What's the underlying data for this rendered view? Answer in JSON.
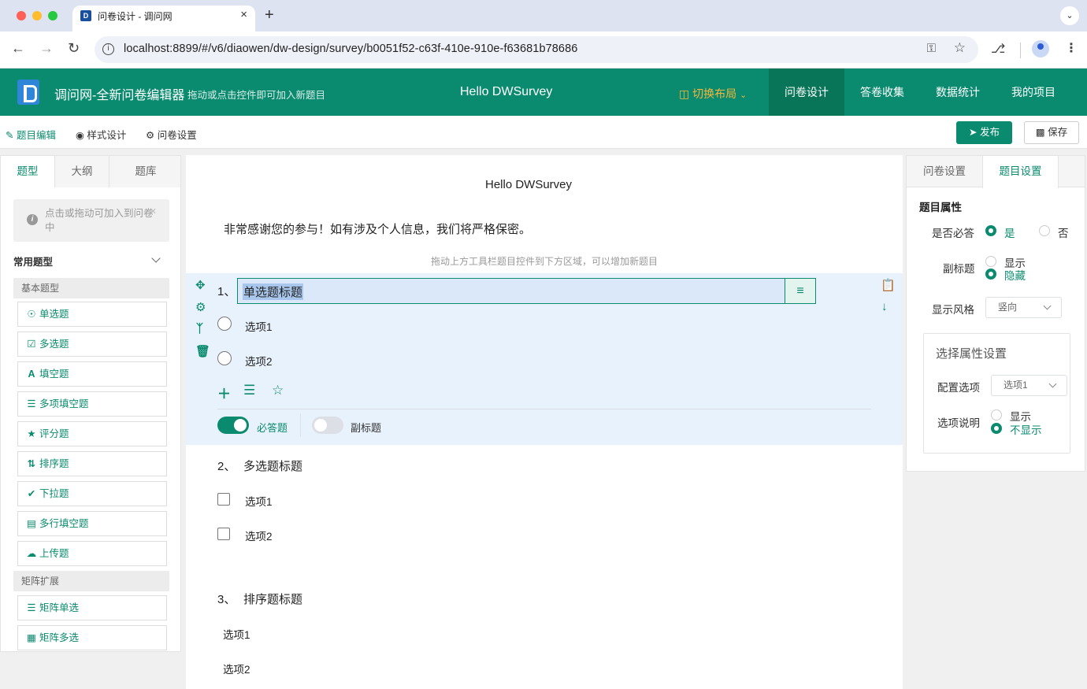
{
  "browser": {
    "tab_title": "问卷设计 - 调问网",
    "tab_favicon_letter": "D",
    "tab_close": "×",
    "new_tab": "+",
    "url": "localhost:8899/#/v6/diaowen/dw-design/survey/b0051f52-c63f-410e-910e-f63681b78686"
  },
  "header": {
    "app_title": "调问网-全新问卷编辑器",
    "app_subtitle": "拖动或点击控件即可加入新题目",
    "center_title": "Hello DWSurvey",
    "layout_switch": "切换布局",
    "nav": [
      "问卷设计",
      "答卷收集",
      "数据统计",
      "我的项目"
    ]
  },
  "subtoolbar": {
    "items": [
      "题目编辑",
      "样式设计",
      "问卷设置"
    ],
    "publish": "发布",
    "save": "保存"
  },
  "left_panel": {
    "tabs": [
      "题型",
      "大纲",
      "题库"
    ],
    "tip": "点击或拖动可加入到问卷中",
    "group_title": "常用题型",
    "categories": [
      "基本题型",
      "矩阵扩展"
    ],
    "basic_items": [
      "单选题",
      "多选题",
      "填空题",
      "多项填空题",
      "评分题",
      "排序题",
      "下拉题",
      "多行填空题",
      "上传题"
    ],
    "matrix_items": [
      "矩阵单选",
      "矩阵多选"
    ]
  },
  "canvas": {
    "survey_title": "Hello DWSurvey",
    "intro": "非常感谢您的参与！如有涉及个人信息，我们将严格保密。",
    "drag_hint": "拖动上方工具栏题目控件到下方区域，可以增加新题目",
    "questions": [
      {
        "num": "1、",
        "title": "单选题标题",
        "options": [
          "选项1",
          "选项2"
        ]
      },
      {
        "num": "2、",
        "title": "多选题标题",
        "options": [
          "选项1",
          "选项2"
        ]
      },
      {
        "num": "3、",
        "title": "排序题标题",
        "options": [
          "选项1",
          "选项2"
        ]
      }
    ],
    "required_switch_label": "必答题",
    "required_on": true,
    "subtitle_switch_label": "副标题",
    "subtitle_on": false
  },
  "right_panel": {
    "tabs": [
      "问卷设置",
      "题目设置"
    ],
    "section_title": "题目属性",
    "required_label": "是否必答",
    "required_yes": "是",
    "required_no": "否",
    "subtitle_label": "副标题",
    "subtitle_show": "显示",
    "subtitle_hide": "隐藏",
    "style_label": "显示风格",
    "style_value": "竖向",
    "option_box_title": "选择属性设置",
    "config_label": "配置选项",
    "config_value": "选项1",
    "desc_label": "选项说明",
    "desc_show": "显示",
    "desc_hide": "不显示"
  },
  "colors": {
    "brand": "#0a8a6e",
    "brand_active": "#087458",
    "warning": "#f6b73c",
    "selection_bg": "#e8f2fd"
  }
}
